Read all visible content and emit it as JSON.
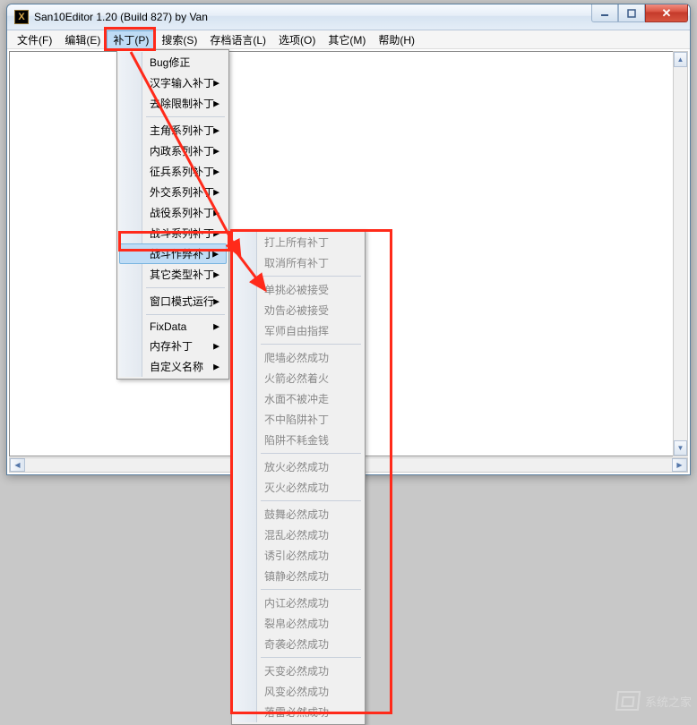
{
  "window": {
    "title": "San10Editor 1.20 (Build 827) by Van",
    "icon_letter": "X"
  },
  "menubar": [
    "文件(F)",
    "编辑(E)",
    "补丁(P)",
    "搜索(S)",
    "存档语言(L)",
    "选项(O)",
    "其它(M)",
    "帮助(H)"
  ],
  "menubar_active_index": 2,
  "dropdown1": {
    "groups": [
      [
        "Bug修正",
        "汉字输入补丁",
        "去除限制补丁"
      ],
      [
        "主角系列补丁",
        "内政系列补丁",
        "征兵系列补丁",
        "外交系列补丁",
        "战役系列补丁",
        "战斗系列补丁",
        "战斗作弊补丁",
        "其它类型补丁"
      ],
      [
        "窗口模式运行"
      ],
      [
        "FixData",
        "内存补丁",
        "自定义名称"
      ]
    ],
    "hover_path": "groups.1.6",
    "no_arrow": [
      "Bug修正"
    ]
  },
  "dropdown2": {
    "groups": [
      [
        "打上所有补丁",
        "取消所有补丁"
      ],
      [
        "单挑必被接受",
        "劝告必被接受",
        "军师自由指挥"
      ],
      [
        "爬墙必然成功",
        "火箭必然着火",
        "水面不被冲走",
        "不中陷阱补丁",
        "陷阱不耗金钱"
      ],
      [
        "放火必然成功",
        "灭火必然成功"
      ],
      [
        "鼓舞必然成功",
        "混乱必然成功",
        "诱引必然成功",
        "镇静必然成功"
      ],
      [
        "内讧必然成功",
        "裂帛必然成功",
        "奇袭必然成功"
      ],
      [
        "天变必然成功",
        "风变必然成功",
        "落雷必然成功"
      ]
    ]
  },
  "watermark_text": "系统之家"
}
